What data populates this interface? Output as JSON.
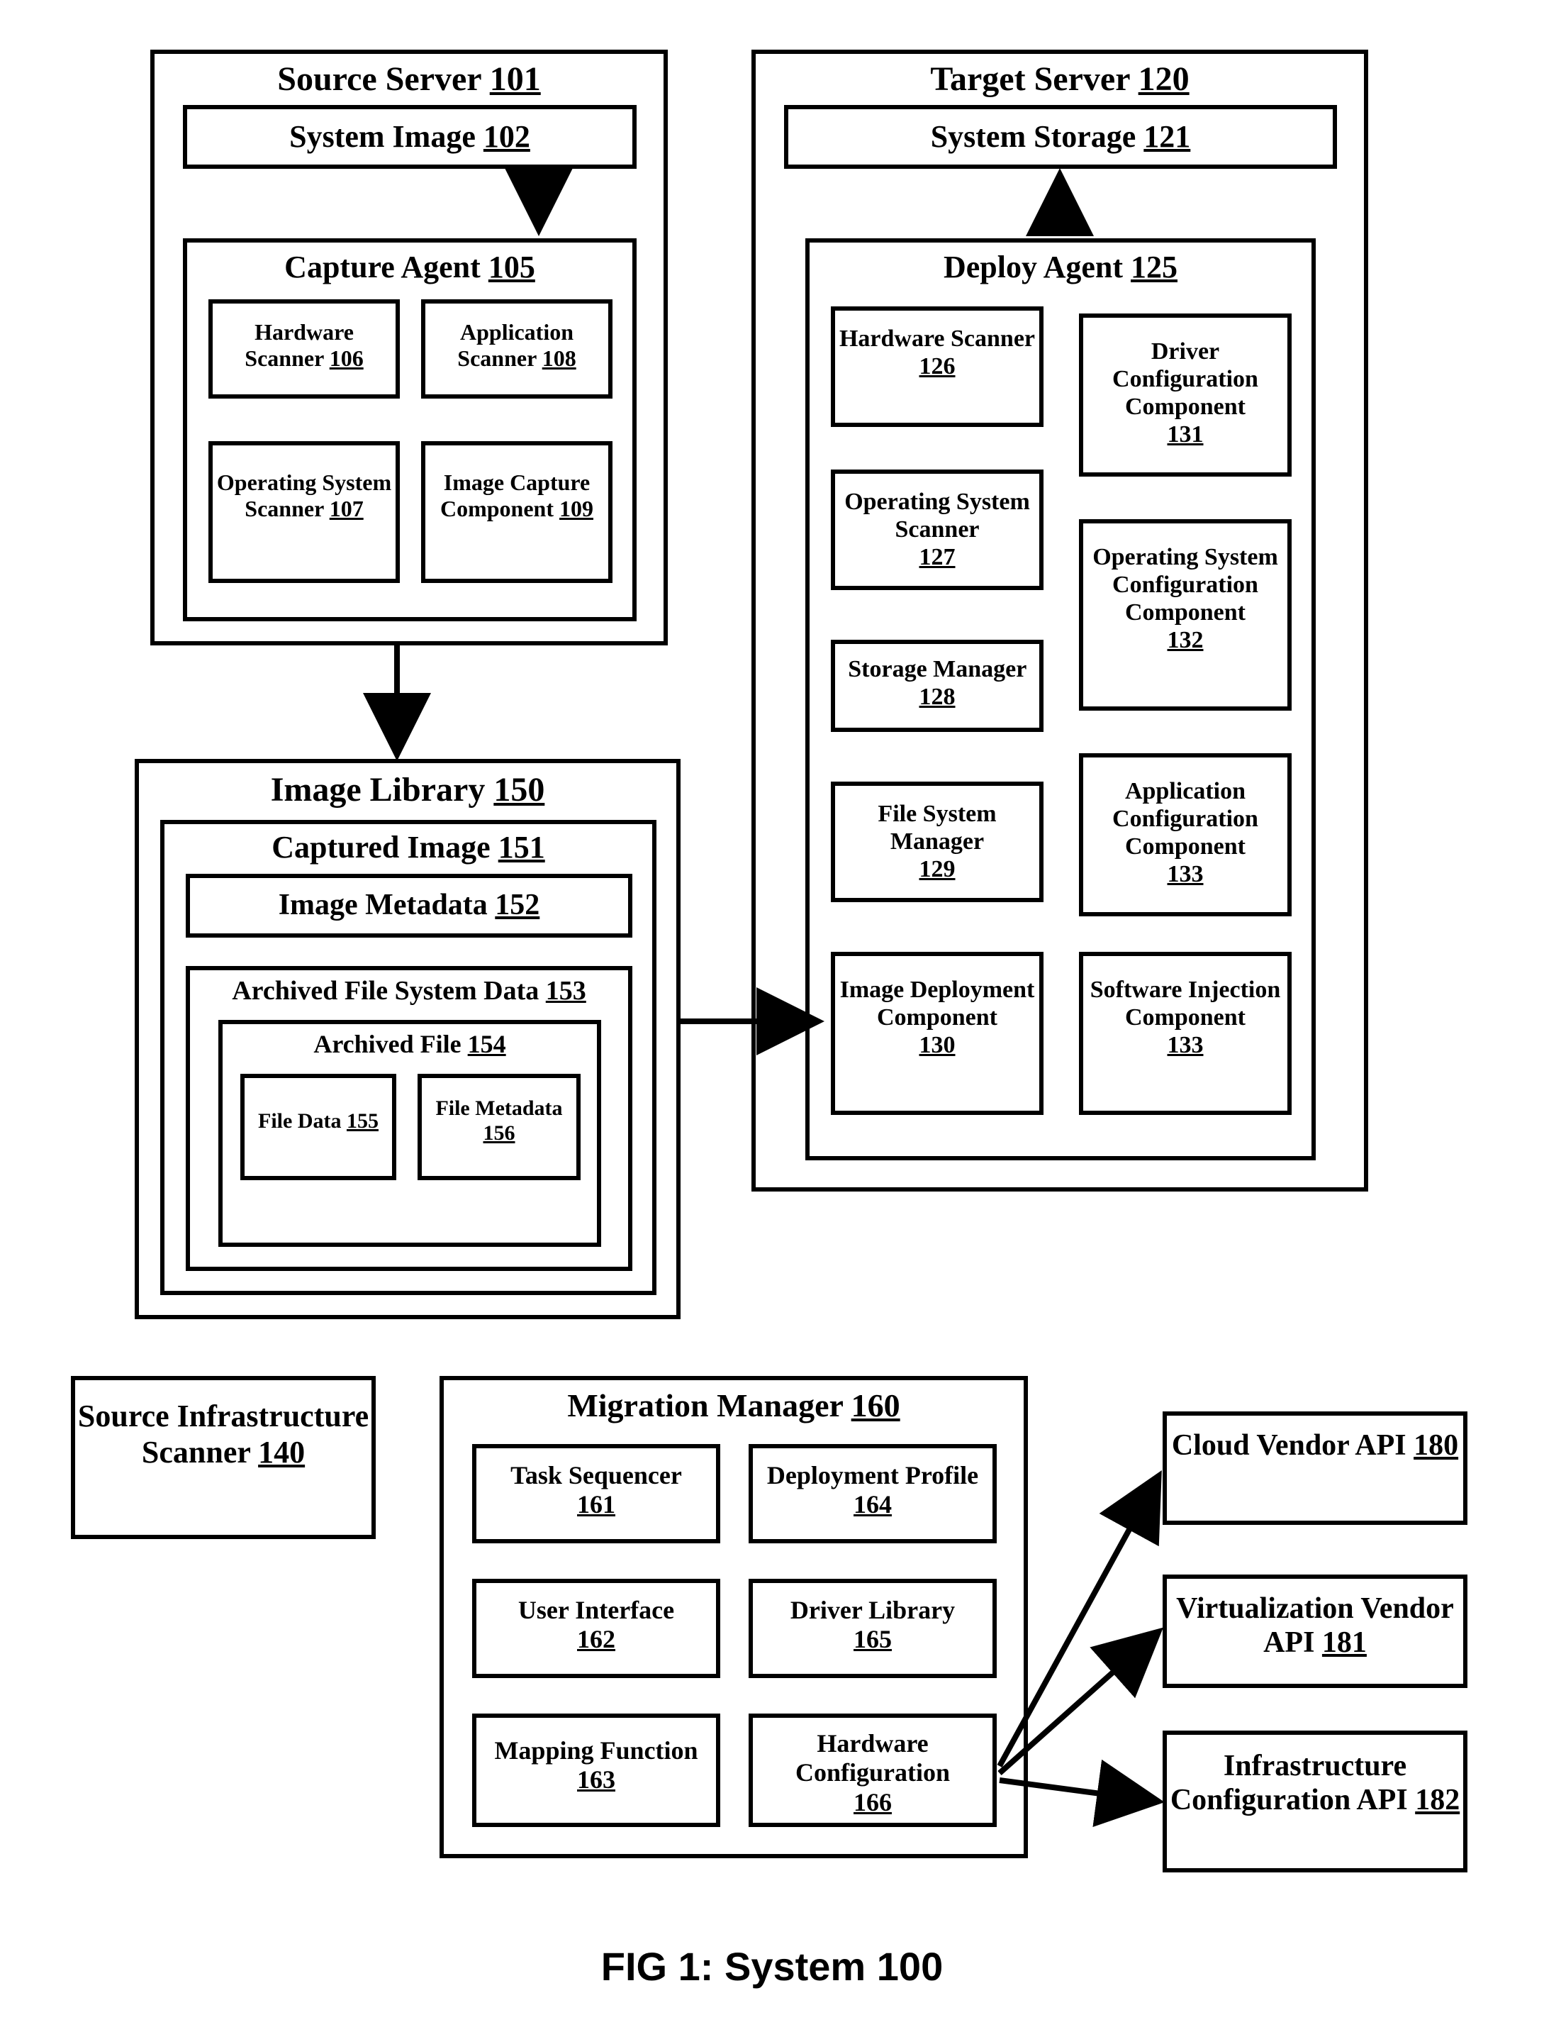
{
  "source_server": {
    "label": "Source Server",
    "num": "101"
  },
  "system_image": {
    "label": "System Image",
    "num": "102"
  },
  "capture_agent": {
    "label": "Capture Agent",
    "num": "105",
    "hw_scanner": {
      "label": "Hardware Scanner",
      "num": "106"
    },
    "app_scanner": {
      "label": "Application Scanner",
      "num": "108"
    },
    "os_scanner": {
      "label": "Operating System Scanner",
      "num": "107"
    },
    "img_capture": {
      "label": "Image Capture Component",
      "num": "109"
    }
  },
  "target_server": {
    "label": "Target Server",
    "num": "120"
  },
  "system_storage": {
    "label": "System Storage",
    "num": "121"
  },
  "deploy_agent": {
    "label": "Deploy Agent",
    "num": "125",
    "hw_scanner": {
      "label": "Hardware Scanner",
      "num": "126"
    },
    "os_scanner": {
      "label": "Operating System Scanner",
      "num": "127"
    },
    "storage_mgr": {
      "label": "Storage Manager",
      "num": "128"
    },
    "fs_mgr": {
      "label": "File System Manager",
      "num": "129"
    },
    "img_deploy": {
      "label": "Image Deployment Component",
      "num": "130"
    },
    "drv_cfg": {
      "label": "Driver Configuration Component",
      "num": "131"
    },
    "os_cfg": {
      "label": "Operating System Configuration Component",
      "num": "132"
    },
    "app_cfg": {
      "label": "Application Configuration Component",
      "num": "133"
    },
    "sw_inj": {
      "label": "Software Injection Component",
      "num": "133"
    }
  },
  "image_library": {
    "label": "Image Library",
    "num": "150"
  },
  "captured_image": {
    "label": "Captured Image",
    "num": "151"
  },
  "image_metadata": {
    "label": "Image Metadata",
    "num": "152"
  },
  "archived_fsd": {
    "label": "Archived File System Data",
    "num": "153"
  },
  "archived_file": {
    "label": "Archived File",
    "num": "154"
  },
  "file_data": {
    "label": "File Data",
    "num": "155"
  },
  "file_metadata": {
    "label": "File Metadata",
    "num": "156"
  },
  "src_infra_scanner": {
    "label": "Source Infrastructure Scanner",
    "num": "140"
  },
  "migration_manager": {
    "label": "Migration Manager",
    "num": "160",
    "task_seq": {
      "label": "Task Sequencer",
      "num": "161"
    },
    "ui": {
      "label": "User Interface",
      "num": "162"
    },
    "map_fn": {
      "label": "Mapping Function",
      "num": "163"
    },
    "dep_prof": {
      "label": "Deployment Profile",
      "num": "164"
    },
    "drv_lib": {
      "label": "Driver Library",
      "num": "165"
    },
    "hw_cfg": {
      "label": "Hardware Configuration",
      "num": "166"
    }
  },
  "cloud_api": {
    "label": "Cloud Vendor API",
    "num": "180"
  },
  "virt_api": {
    "label": "Virtualization Vendor API",
    "num": "181"
  },
  "infra_api": {
    "label": "Infrastructure Configuration API",
    "num": "182"
  },
  "figure_caption": {
    "label": "FIG 1: System 100"
  }
}
